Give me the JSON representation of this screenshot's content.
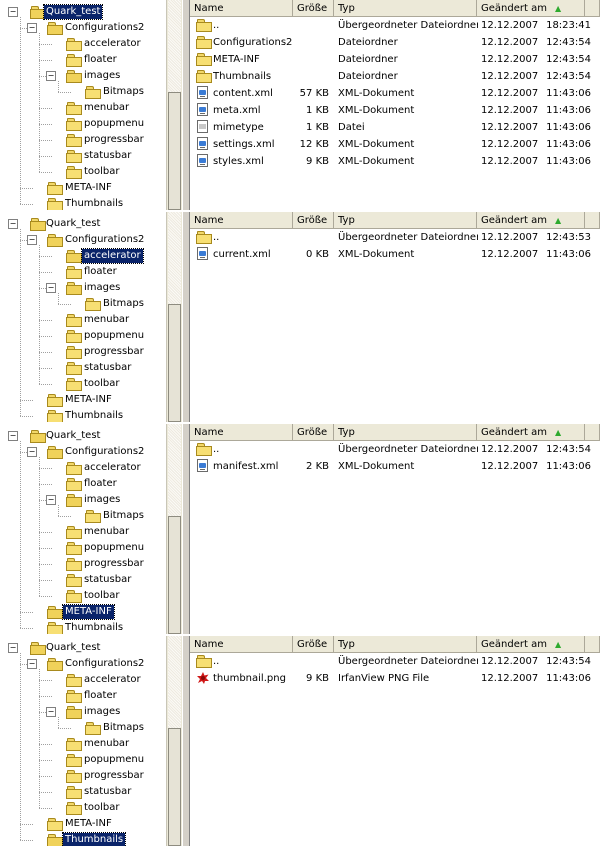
{
  "tree_labels": [
    "Quark_test",
    "Configurations2",
    "accelerator",
    "floater",
    "images",
    "Bitmaps",
    "menubar",
    "popupmenu",
    "progressbar",
    "statusbar",
    "toolbar",
    "META-INF",
    "Thumbnails"
  ],
  "columns": {
    "name": "Name",
    "size": "Größe",
    "type": "Typ",
    "modified": "Geändert am",
    "sort_indicator": "▲"
  },
  "panels": [
    {
      "selected": "Quark_test",
      "files": [
        {
          "icon": "folder-up-icon",
          "name": "..",
          "size": "",
          "type": "Übergeordneter Dateiordner",
          "date": "12.12.2007",
          "time": "18:23:41"
        },
        {
          "icon": "folder-icon",
          "name": "Configurations2",
          "size": "",
          "type": "Dateiordner",
          "date": "12.12.2007",
          "time": "12:43:54"
        },
        {
          "icon": "folder-icon",
          "name": "META-INF",
          "size": "",
          "type": "Dateiordner",
          "date": "12.12.2007",
          "time": "12:43:54"
        },
        {
          "icon": "folder-icon",
          "name": "Thumbnails",
          "size": "",
          "type": "Dateiordner",
          "date": "12.12.2007",
          "time": "12:43:54"
        },
        {
          "icon": "xml-file-icon",
          "name": "content.xml",
          "size": "57 KB",
          "type": "XML-Dokument",
          "date": "12.12.2007",
          "time": "11:43:06"
        },
        {
          "icon": "xml-file-icon",
          "name": "meta.xml",
          "size": "1 KB",
          "type": "XML-Dokument",
          "date": "12.12.2007",
          "time": "11:43:06"
        },
        {
          "icon": "file-icon",
          "name": "mimetype",
          "size": "1 KB",
          "type": "Datei",
          "date": "12.12.2007",
          "time": "11:43:06"
        },
        {
          "icon": "xml-file-icon",
          "name": "settings.xml",
          "size": "12 KB",
          "type": "XML-Dokument",
          "date": "12.12.2007",
          "time": "11:43:06"
        },
        {
          "icon": "xml-file-icon",
          "name": "styles.xml",
          "size": "9 KB",
          "type": "XML-Dokument",
          "date": "12.12.2007",
          "time": "11:43:06"
        }
      ]
    },
    {
      "selected": "accelerator",
      "files": [
        {
          "icon": "folder-up-icon",
          "name": "..",
          "size": "",
          "type": "Übergeordneter Dateiordner",
          "date": "12.12.2007",
          "time": "12:43:53"
        },
        {
          "icon": "xml-file-icon",
          "name": "current.xml",
          "size": "0 KB",
          "type": "XML-Dokument",
          "date": "12.12.2007",
          "time": "11:43:06"
        }
      ]
    },
    {
      "selected": "META-INF",
      "files": [
        {
          "icon": "folder-up-icon",
          "name": "..",
          "size": "",
          "type": "Übergeordneter Dateiordner",
          "date": "12.12.2007",
          "time": "12:43:54"
        },
        {
          "icon": "xml-file-icon",
          "name": "manifest.xml",
          "size": "2 KB",
          "type": "XML-Dokument",
          "date": "12.12.2007",
          "time": "11:43:06"
        }
      ]
    },
    {
      "selected": "Thumbnails",
      "files": [
        {
          "icon": "folder-up-icon",
          "name": "..",
          "size": "",
          "type": "Übergeordneter Dateiordner",
          "date": "12.12.2007",
          "time": "12:43:54"
        },
        {
          "icon": "png-file-icon",
          "name": "thumbnail.png",
          "size": "9 KB",
          "type": "IrfanView PNG File",
          "date": "12.12.2007",
          "time": "11:43:06"
        }
      ]
    }
  ]
}
